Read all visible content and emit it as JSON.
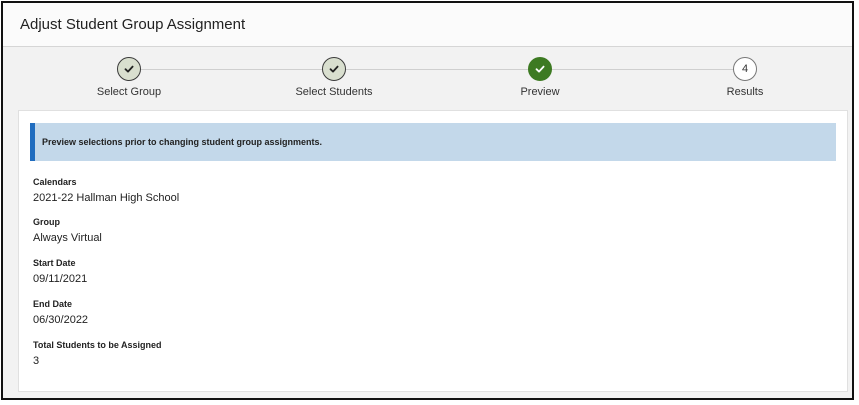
{
  "title": "Adjust Student Group Assignment",
  "steps": [
    {
      "label": "Select Group",
      "state": "complete",
      "icon": "check-icon"
    },
    {
      "label": "Select Students",
      "state": "complete",
      "icon": "check-icon"
    },
    {
      "label": "Preview",
      "state": "current",
      "icon": "check-icon"
    },
    {
      "label": "Results",
      "state": "pending",
      "number": "4"
    }
  ],
  "banner": {
    "text": "Preview selections prior to changing student group assignments.",
    "color": "#c3d8ea",
    "accent": "#1f6cbf"
  },
  "fields": {
    "calendars": {
      "label": "Calendars",
      "value": "2021-22 Hallman High School"
    },
    "group": {
      "label": "Group",
      "value": "Always Virtual"
    },
    "start_date": {
      "label": "Start Date",
      "value": "09/11/2021"
    },
    "end_date": {
      "label": "End Date",
      "value": "06/30/2022"
    },
    "total_students": {
      "label": "Total Students to be Assigned",
      "value": "3"
    }
  },
  "colors": {
    "current_step": "#3d7a22",
    "completed_step": "#d9dfcf"
  }
}
